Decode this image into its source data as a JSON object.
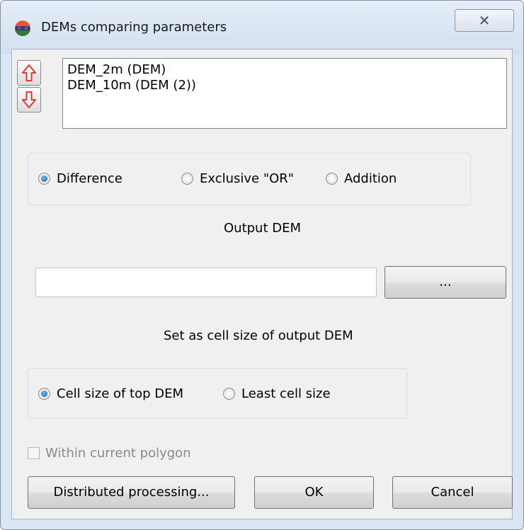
{
  "window": {
    "title": "DEMs comparing parameters",
    "close_symbol": "✕"
  },
  "layers": [
    "DEM_2m (DEM)",
    "DEM_10m (DEM (2))"
  ],
  "operation": {
    "options": [
      "Difference",
      "Exclusive \"OR\"",
      "Addition"
    ],
    "selected": "Difference"
  },
  "output": {
    "label": "Output DEM",
    "value": "",
    "browse_label": "..."
  },
  "cell_size": {
    "label": "Set as cell size of output DEM",
    "options": [
      "Cell size of top DEM",
      "Least cell size"
    ],
    "selected": "Cell size of top DEM"
  },
  "polygon_checkbox": {
    "label": "Within current polygon",
    "checked": false,
    "enabled": false
  },
  "buttons": {
    "distributed": "Distributed processing...",
    "ok": "OK",
    "cancel": "Cancel"
  },
  "colors": {
    "arrow": "#e0392b",
    "radio_selected": "#2a74c9",
    "title_bar": "#dbe6f4"
  },
  "icons": {
    "app": "dem-compare-icon",
    "up": "arrow-up-icon",
    "down": "arrow-down-icon",
    "close": "close-icon"
  }
}
